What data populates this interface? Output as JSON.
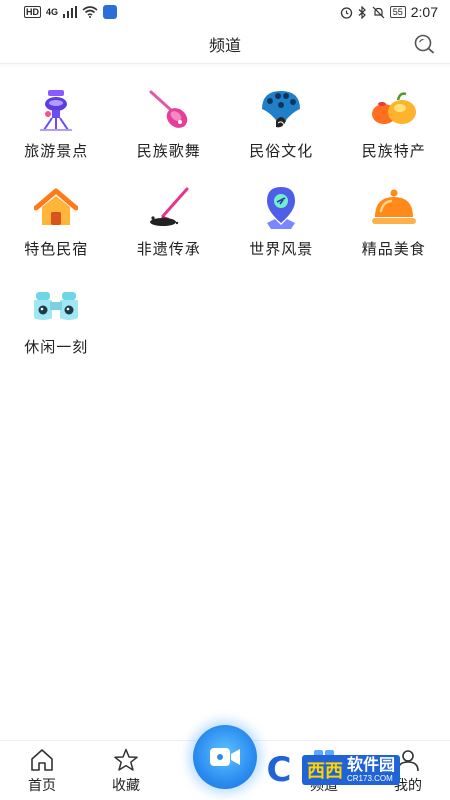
{
  "status_bar": {
    "hd": "HD",
    "signal": "4G",
    "battery": "55",
    "time": "2:07"
  },
  "header": {
    "title": "频道"
  },
  "channels": [
    {
      "label": "旅游景点",
      "icon": "tourist-spot-icon"
    },
    {
      "label": "民族歌舞",
      "icon": "pipa-icon"
    },
    {
      "label": "民俗文化",
      "icon": "peacock-icon"
    },
    {
      "label": "民族特产",
      "icon": "specialty-icon"
    },
    {
      "label": "特色民宿",
      "icon": "house-icon"
    },
    {
      "label": "非遗传承",
      "icon": "brush-icon"
    },
    {
      "label": "世界风景",
      "icon": "map-pin-icon"
    },
    {
      "label": "精品美食",
      "icon": "food-cloche-icon"
    },
    {
      "label": "休闲一刻",
      "icon": "binoculars-icon"
    }
  ],
  "bottom_nav": {
    "home": "首页",
    "favorites": "收藏",
    "channel": "频道",
    "mine": "我的"
  },
  "watermark": {
    "xixi": "西西",
    "name": "软件园",
    "site": "CR173.COM"
  },
  "colors": {
    "accent": "#2b8cf0",
    "text": "#222222"
  }
}
